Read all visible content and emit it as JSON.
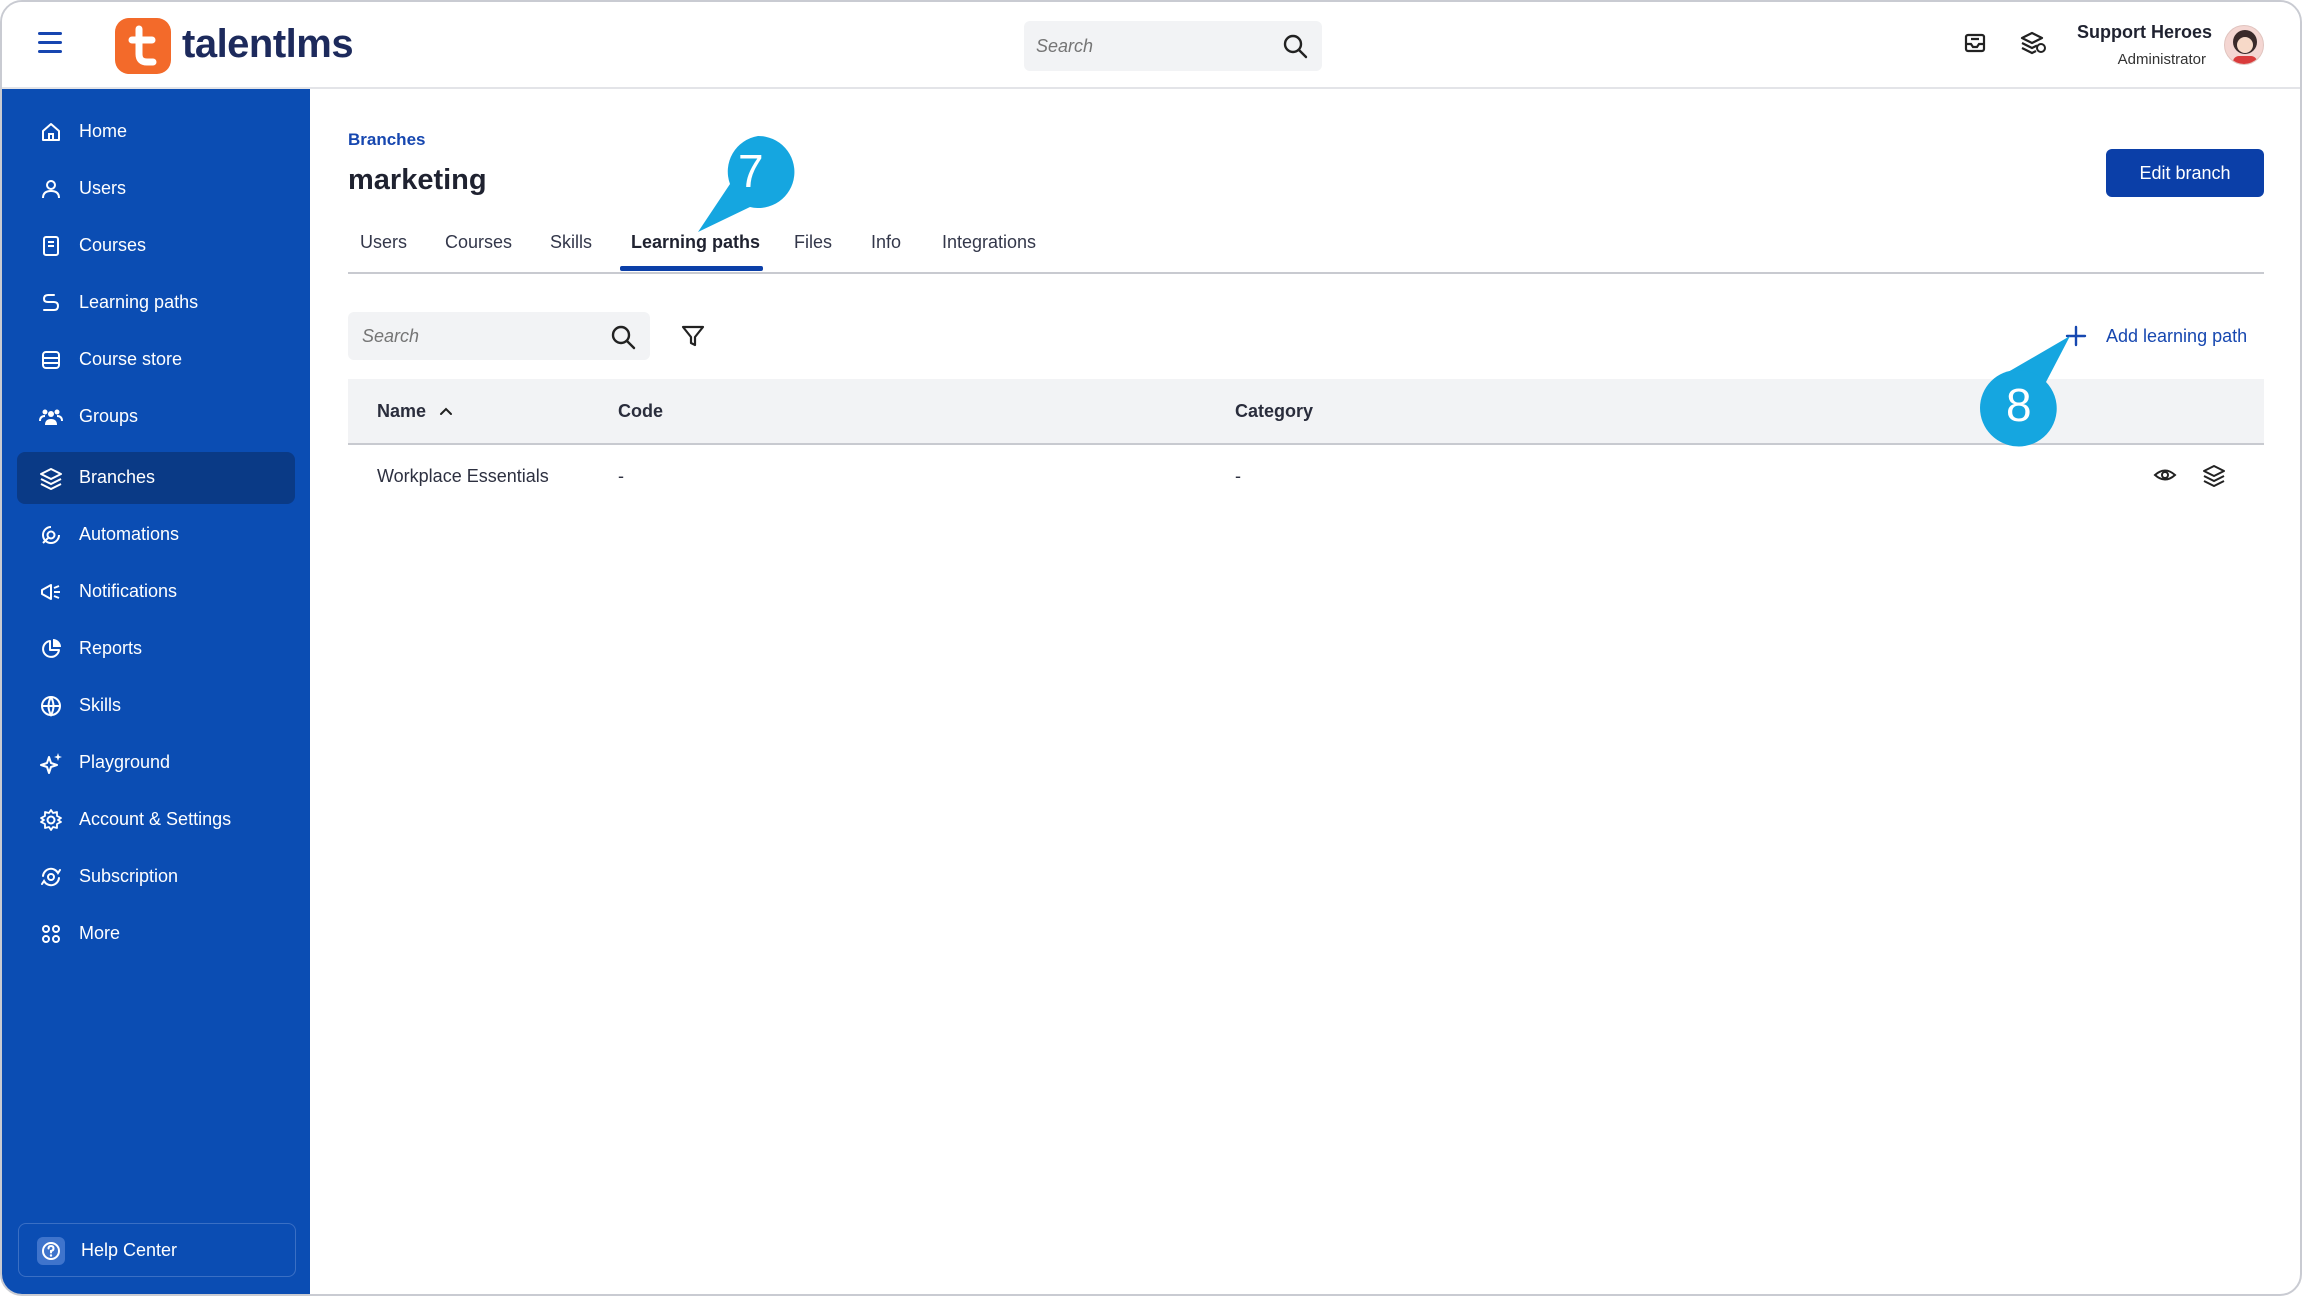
{
  "app": {
    "logo_text": "talentlms",
    "search_placeholder": "Search"
  },
  "user": {
    "name": "Support Heroes",
    "role": "Administrator"
  },
  "sidebar": {
    "items": [
      {
        "label": "Home",
        "icon": "home-icon"
      },
      {
        "label": "Users",
        "icon": "user-icon"
      },
      {
        "label": "Courses",
        "icon": "book-icon"
      },
      {
        "label": "Learning paths",
        "icon": "path-icon"
      },
      {
        "label": "Course store",
        "icon": "store-icon"
      },
      {
        "label": "Groups",
        "icon": "groups-icon"
      },
      {
        "label": "Branches",
        "icon": "layers-icon",
        "active": true
      },
      {
        "label": "Automations",
        "icon": "automation-icon"
      },
      {
        "label": "Notifications",
        "icon": "megaphone-icon"
      },
      {
        "label": "Reports",
        "icon": "pie-chart-icon"
      },
      {
        "label": "Skills",
        "icon": "globe-icon"
      },
      {
        "label": "Playground",
        "icon": "sparkle-icon"
      },
      {
        "label": "Account & Settings",
        "icon": "gear-icon"
      },
      {
        "label": "Subscription",
        "icon": "refresh-icon"
      },
      {
        "label": "More",
        "icon": "grid-icon"
      }
    ],
    "help_label": "Help Center"
  },
  "page": {
    "breadcrumb": "Branches",
    "title": "marketing",
    "edit_button": "Edit branch"
  },
  "tabs": [
    "Users",
    "Courses",
    "Skills",
    "Learning paths",
    "Files",
    "Info",
    "Integrations"
  ],
  "active_tab": "Learning paths",
  "toolbar": {
    "search_placeholder": "Search",
    "add_label": "Add learning path"
  },
  "table": {
    "columns": [
      "Name",
      "Code",
      "Category"
    ],
    "rows": [
      {
        "name": "Workplace Essentials",
        "code": "-",
        "category": "-"
      }
    ]
  },
  "callouts": {
    "step_a": "7",
    "step_b": "8"
  },
  "colors": {
    "brand_blue": "#0b4db3",
    "active_nav": "#0a3a86",
    "primary_button": "#0b3fa8",
    "logo_orange": "#f36a2a",
    "callout_cyan": "#15a6e0"
  }
}
